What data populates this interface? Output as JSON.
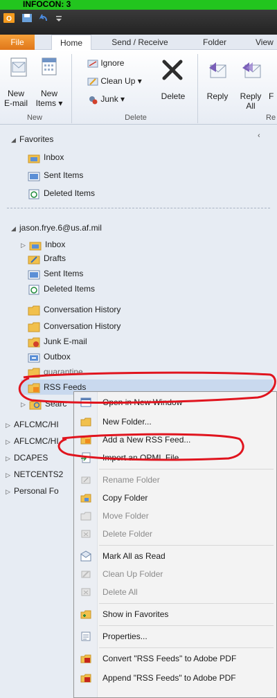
{
  "banner": {
    "text": "INFOCON: 3"
  },
  "tabs": [
    {
      "label": "File"
    },
    {
      "label": "Home"
    },
    {
      "label": "Send / Receive"
    },
    {
      "label": "Folder"
    },
    {
      "label": "View"
    }
  ],
  "ribbon": {
    "new_email": [
      "New",
      "E-mail"
    ],
    "new_items": [
      "New",
      "Items ▾"
    ],
    "group_new": "New",
    "ignore": "Ignore",
    "cleanup": "Clean Up ▾",
    "junk": "Junk ▾",
    "delete": "Delete",
    "group_delete": "Delete",
    "reply": "Reply",
    "reply_all": [
      "Reply",
      "All"
    ],
    "group_respond": "Re"
  },
  "favorites": {
    "header": "Favorites",
    "items": [
      "Inbox",
      "Sent Items",
      "Deleted Items"
    ]
  },
  "account": {
    "header": "jason.frye.6@us.af.mil",
    "items": [
      "Inbox",
      "Drafts",
      "Sent Items",
      "Deleted Items",
      "Conversation History",
      "Conversation History",
      "Junk E-mail",
      "Outbox",
      "quarantine",
      "RSS Feeds",
      "Searc"
    ]
  },
  "other_accounts": [
    "AFLCMC/HI",
    "AFLCMC/HI",
    "DCAPES",
    "NETCENTS2",
    "Personal Fo"
  ],
  "context_menu": {
    "items": [
      {
        "label": "Open in New Window",
        "icon": "open-window-icon",
        "disabled": false
      },
      {
        "label": "New Folder...",
        "icon": "new-folder-icon",
        "disabled": false
      },
      {
        "label": "Add a New RSS Feed...",
        "icon": "rss-add-icon",
        "disabled": false
      },
      {
        "label": "Import an OPML File...",
        "icon": "import-icon",
        "disabled": false
      },
      {
        "label": "Rename Folder",
        "icon": "rename-icon",
        "disabled": true
      },
      {
        "label": "Copy Folder",
        "icon": "copy-folder-icon",
        "disabled": false
      },
      {
        "label": "Move Folder",
        "icon": "move-folder-icon",
        "disabled": true
      },
      {
        "label": "Delete Folder",
        "icon": "delete-folder-icon",
        "disabled": true
      },
      {
        "label": "Mark All as Read",
        "icon": "mark-read-icon",
        "disabled": false
      },
      {
        "label": "Clean Up Folder",
        "icon": "cleanup-folder-icon",
        "disabled": true
      },
      {
        "label": "Delete All",
        "icon": "delete-all-icon",
        "disabled": true
      },
      {
        "label": "Show in Favorites",
        "icon": "favorites-icon",
        "disabled": false
      },
      {
        "label": "Properties...",
        "icon": "properties-icon",
        "disabled": false
      },
      {
        "label": "Convert \"RSS Feeds\" to Adobe PDF",
        "icon": "pdf-convert-icon",
        "disabled": false
      },
      {
        "label": "Append \"RSS Feeds\" to Adobe PDF",
        "icon": "pdf-append-icon",
        "disabled": false
      }
    ]
  },
  "colors": {
    "banner": "#22c51e",
    "file_tab": "#e8821f",
    "annotation": "#e0141e",
    "folder": "#f1c04c"
  }
}
